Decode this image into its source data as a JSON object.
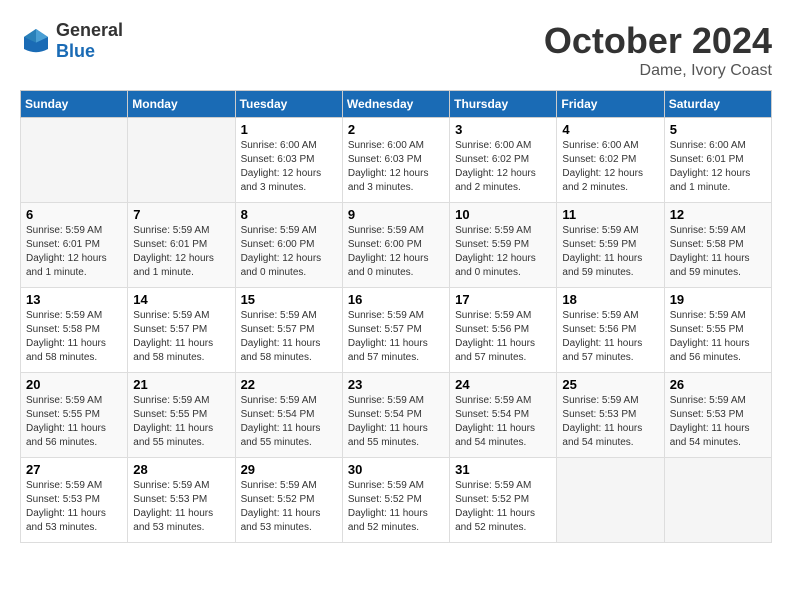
{
  "header": {
    "logo_line1": "General",
    "logo_line2": "Blue",
    "month": "October 2024",
    "location": "Dame, Ivory Coast"
  },
  "columns": [
    "Sunday",
    "Monday",
    "Tuesday",
    "Wednesday",
    "Thursday",
    "Friday",
    "Saturday"
  ],
  "weeks": [
    [
      {
        "day": "",
        "info": ""
      },
      {
        "day": "",
        "info": ""
      },
      {
        "day": "1",
        "info": "Sunrise: 6:00 AM\nSunset: 6:03 PM\nDaylight: 12 hours and 3 minutes."
      },
      {
        "day": "2",
        "info": "Sunrise: 6:00 AM\nSunset: 6:03 PM\nDaylight: 12 hours and 3 minutes."
      },
      {
        "day": "3",
        "info": "Sunrise: 6:00 AM\nSunset: 6:02 PM\nDaylight: 12 hours and 2 minutes."
      },
      {
        "day": "4",
        "info": "Sunrise: 6:00 AM\nSunset: 6:02 PM\nDaylight: 12 hours and 2 minutes."
      },
      {
        "day": "5",
        "info": "Sunrise: 6:00 AM\nSunset: 6:01 PM\nDaylight: 12 hours and 1 minute."
      }
    ],
    [
      {
        "day": "6",
        "info": "Sunrise: 5:59 AM\nSunset: 6:01 PM\nDaylight: 12 hours and 1 minute."
      },
      {
        "day": "7",
        "info": "Sunrise: 5:59 AM\nSunset: 6:01 PM\nDaylight: 12 hours and 1 minute."
      },
      {
        "day": "8",
        "info": "Sunrise: 5:59 AM\nSunset: 6:00 PM\nDaylight: 12 hours and 0 minutes."
      },
      {
        "day": "9",
        "info": "Sunrise: 5:59 AM\nSunset: 6:00 PM\nDaylight: 12 hours and 0 minutes."
      },
      {
        "day": "10",
        "info": "Sunrise: 5:59 AM\nSunset: 5:59 PM\nDaylight: 12 hours and 0 minutes."
      },
      {
        "day": "11",
        "info": "Sunrise: 5:59 AM\nSunset: 5:59 PM\nDaylight: 11 hours and 59 minutes."
      },
      {
        "day": "12",
        "info": "Sunrise: 5:59 AM\nSunset: 5:58 PM\nDaylight: 11 hours and 59 minutes."
      }
    ],
    [
      {
        "day": "13",
        "info": "Sunrise: 5:59 AM\nSunset: 5:58 PM\nDaylight: 11 hours and 58 minutes."
      },
      {
        "day": "14",
        "info": "Sunrise: 5:59 AM\nSunset: 5:57 PM\nDaylight: 11 hours and 58 minutes."
      },
      {
        "day": "15",
        "info": "Sunrise: 5:59 AM\nSunset: 5:57 PM\nDaylight: 11 hours and 58 minutes."
      },
      {
        "day": "16",
        "info": "Sunrise: 5:59 AM\nSunset: 5:57 PM\nDaylight: 11 hours and 57 minutes."
      },
      {
        "day": "17",
        "info": "Sunrise: 5:59 AM\nSunset: 5:56 PM\nDaylight: 11 hours and 57 minutes."
      },
      {
        "day": "18",
        "info": "Sunrise: 5:59 AM\nSunset: 5:56 PM\nDaylight: 11 hours and 57 minutes."
      },
      {
        "day": "19",
        "info": "Sunrise: 5:59 AM\nSunset: 5:55 PM\nDaylight: 11 hours and 56 minutes."
      }
    ],
    [
      {
        "day": "20",
        "info": "Sunrise: 5:59 AM\nSunset: 5:55 PM\nDaylight: 11 hours and 56 minutes."
      },
      {
        "day": "21",
        "info": "Sunrise: 5:59 AM\nSunset: 5:55 PM\nDaylight: 11 hours and 55 minutes."
      },
      {
        "day": "22",
        "info": "Sunrise: 5:59 AM\nSunset: 5:54 PM\nDaylight: 11 hours and 55 minutes."
      },
      {
        "day": "23",
        "info": "Sunrise: 5:59 AM\nSunset: 5:54 PM\nDaylight: 11 hours and 55 minutes."
      },
      {
        "day": "24",
        "info": "Sunrise: 5:59 AM\nSunset: 5:54 PM\nDaylight: 11 hours and 54 minutes."
      },
      {
        "day": "25",
        "info": "Sunrise: 5:59 AM\nSunset: 5:53 PM\nDaylight: 11 hours and 54 minutes."
      },
      {
        "day": "26",
        "info": "Sunrise: 5:59 AM\nSunset: 5:53 PM\nDaylight: 11 hours and 54 minutes."
      }
    ],
    [
      {
        "day": "27",
        "info": "Sunrise: 5:59 AM\nSunset: 5:53 PM\nDaylight: 11 hours and 53 minutes."
      },
      {
        "day": "28",
        "info": "Sunrise: 5:59 AM\nSunset: 5:53 PM\nDaylight: 11 hours and 53 minutes."
      },
      {
        "day": "29",
        "info": "Sunrise: 5:59 AM\nSunset: 5:52 PM\nDaylight: 11 hours and 53 minutes."
      },
      {
        "day": "30",
        "info": "Sunrise: 5:59 AM\nSunset: 5:52 PM\nDaylight: 11 hours and 52 minutes."
      },
      {
        "day": "31",
        "info": "Sunrise: 5:59 AM\nSunset: 5:52 PM\nDaylight: 11 hours and 52 minutes."
      },
      {
        "day": "",
        "info": ""
      },
      {
        "day": "",
        "info": ""
      }
    ]
  ]
}
